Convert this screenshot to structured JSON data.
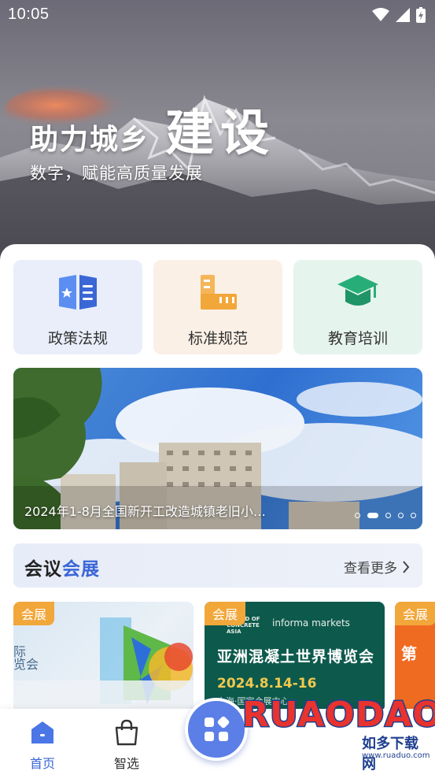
{
  "status_bar": {
    "time": "10:05"
  },
  "hero": {
    "title": "助力城乡",
    "title_big": "建设",
    "subtitle": "数字，赋能高质量发展"
  },
  "quick_links": [
    {
      "label": "政策法规",
      "icon": "policy-book-icon",
      "color": "#3a66d6"
    },
    {
      "label": "标准规范",
      "icon": "ruler-icon",
      "color": "#f2a73a"
    },
    {
      "label": "教育培训",
      "icon": "graduation-cap-icon",
      "color": "#27ae78"
    }
  ],
  "banner": {
    "caption": "2024年1-8月全国新开工改造城镇老旧小…",
    "active_index": 1,
    "dot_count": 5
  },
  "meetings": {
    "title_prefix": "会议",
    "title_accent": "会展",
    "see_more": "查看更多",
    "cards": [
      {
        "tag": "会展",
        "text": "际\n览会"
      },
      {
        "tag": "会展",
        "logo1": "WORLD OF\nCONCRETE\nASIA",
        "logo2": "informa markets",
        "title": "亚洲混凝土世界博览会",
        "date": "2024.8.14-16",
        "sub": "上海·国家会展中心"
      },
      {
        "tag": "会展",
        "text": "第"
      }
    ]
  },
  "bottom_nav": {
    "home_label": "首页",
    "select_label": "智选"
  },
  "watermark": {
    "text": "RUAODAO",
    "cn": "如多下载网",
    "url": "www.ruaduo.com"
  },
  "colors": {
    "accent": "#3a66d6",
    "tag": "#f2a73a",
    "fab": "#5b7fe6"
  }
}
